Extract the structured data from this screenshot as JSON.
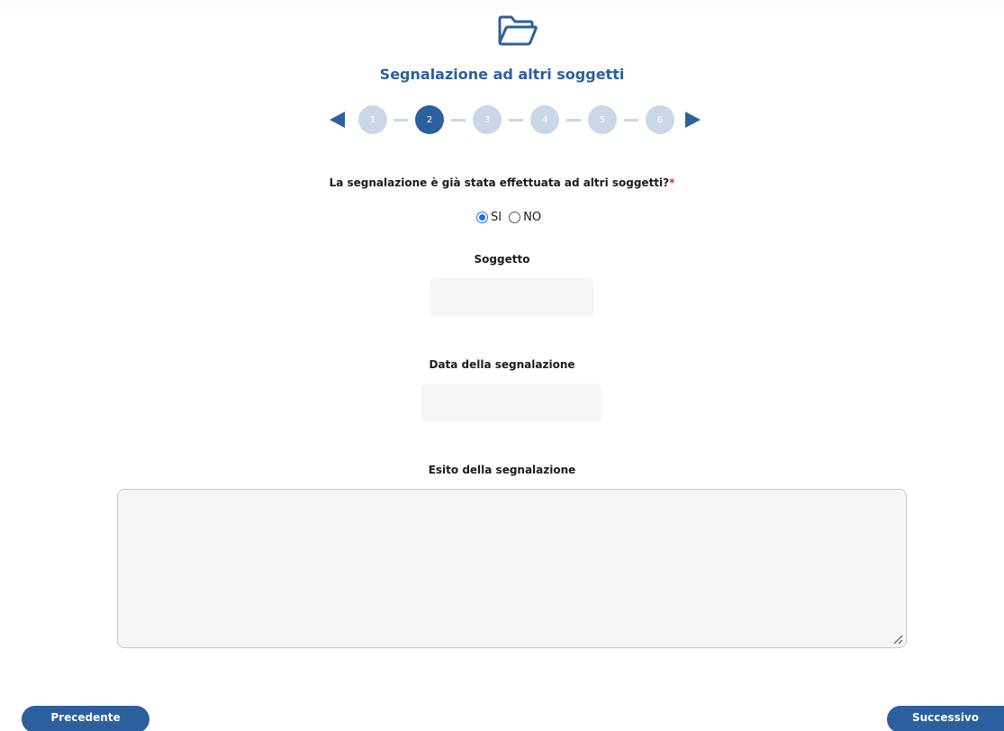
{
  "header": {
    "icon": "folder-open-icon",
    "title": "Segnalazione ad altri soggetti"
  },
  "stepper": {
    "steps": [
      "1",
      "2",
      "3",
      "4",
      "5",
      "6"
    ],
    "current_step": 2,
    "colors": {
      "active": "#2c5f9e",
      "inactive": "#c9d7e6"
    }
  },
  "question": {
    "text": "La segnalazione è già stata effettuata ad altri soggetti?",
    "required_mark": "*",
    "options": [
      {
        "label": "SI",
        "checked": true
      },
      {
        "label": "NO",
        "checked": false
      }
    ]
  },
  "fields": {
    "soggetto": {
      "label": "Soggetto",
      "value": ""
    },
    "data": {
      "label": "Data della segnalazione",
      "value": ""
    },
    "esito": {
      "label": "Esito della segnalazione",
      "value": ""
    }
  },
  "nav": {
    "prev_label": "Precedente",
    "next_label": "Successivo"
  },
  "theme": {
    "accent": "#2c5f9e",
    "required": "#d03030"
  }
}
